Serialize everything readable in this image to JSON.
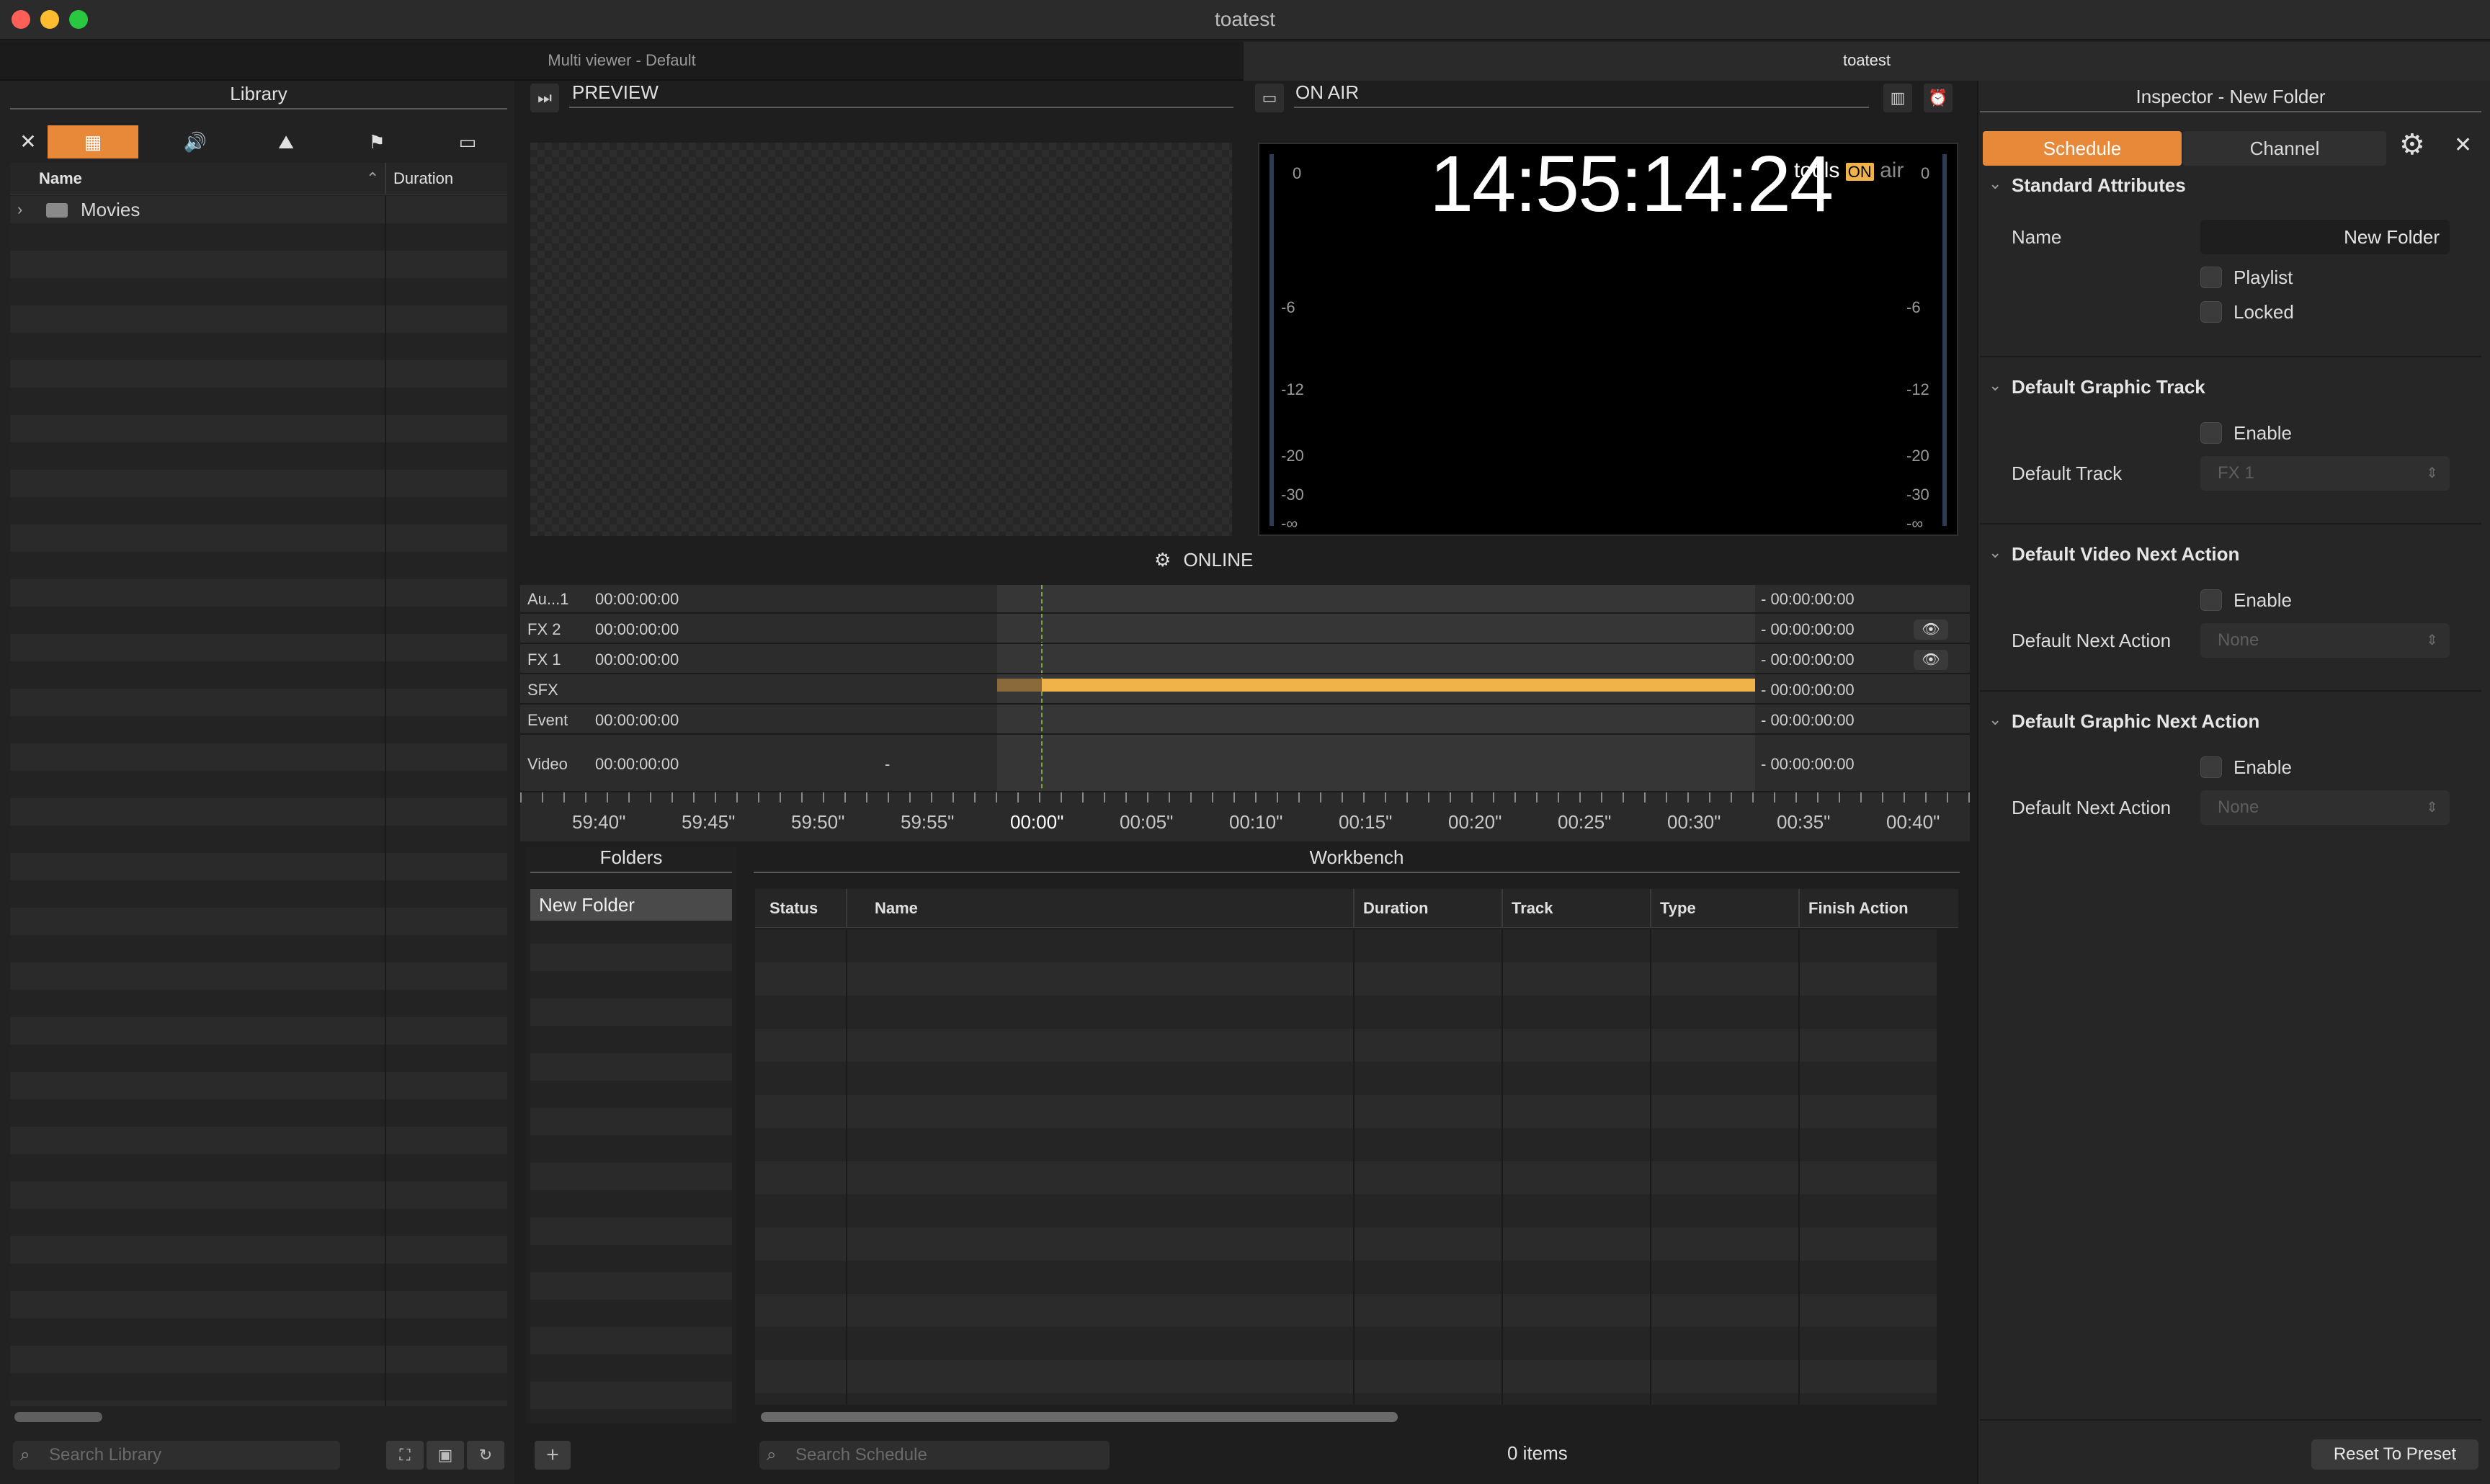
{
  "window": {
    "title": "toatest",
    "traffic_lights": {
      "close": "#fe5f57",
      "minimize": "#febc2e",
      "maximize": "#28c840"
    }
  },
  "tabs": [
    {
      "label": "Multi viewer - Default",
      "active": false
    },
    {
      "label": "toatest",
      "active": true
    }
  ],
  "library": {
    "title": "Library",
    "toolbar": [
      {
        "icon": "close-icon",
        "glyph": "✕",
        "active": false
      },
      {
        "icon": "film-icon",
        "glyph": "▦",
        "active": true
      },
      {
        "icon": "speaker-icon",
        "glyph": "🔊",
        "active": false
      },
      {
        "icon": "mountain-icon",
        "glyph": "⛰",
        "active": false
      },
      {
        "icon": "flag-icon",
        "glyph": "⚑",
        "active": false
      },
      {
        "icon": "window-icon",
        "glyph": "▭",
        "active": false
      }
    ],
    "columns": {
      "name": "Name",
      "duration": "Duration"
    },
    "items": [
      {
        "name": "Movies",
        "type": "folder"
      }
    ],
    "search_placeholder": "Search Library"
  },
  "preview": {
    "title": "PREVIEW"
  },
  "onair": {
    "title": "ON AIR",
    "clock": "14:55:14:24",
    "logo_text": "tools",
    "logo_badge": "ON",
    "logo_tail": "air",
    "meter_labels": [
      "0",
      "-6",
      "-12",
      "-20",
      "-30",
      "-∞"
    ],
    "status": "ONLINE"
  },
  "timeline": {
    "tracks": [
      {
        "name": "Au...1",
        "in": "00:00:00:00",
        "out": "- 00:00:00:00",
        "eye": false
      },
      {
        "name": "FX 2",
        "in": "00:00:00:00",
        "out": "- 00:00:00:00",
        "eye": true
      },
      {
        "name": "FX 1",
        "in": "00:00:00:00",
        "out": "- 00:00:00:00",
        "eye": true
      },
      {
        "name": "SFX",
        "in": "",
        "out": "- 00:00:00:00",
        "eye": false
      },
      {
        "name": "Event",
        "in": "00:00:00:00",
        "out": "- 00:00:00:00",
        "eye": false
      },
      {
        "name": "Video",
        "in": "00:00:00:00",
        "out": "- 00:00:00:00",
        "eye": false,
        "extra": "-"
      }
    ],
    "ruler": [
      "59:40\"",
      "59:45\"",
      "59:50\"",
      "59:55\"",
      "00:00\"",
      "00:05\"",
      "00:10\"",
      "00:15\"",
      "00:20\"",
      "00:25\"",
      "00:30\"",
      "00:35\"",
      "00:40\""
    ],
    "accent": "#f0b34a"
  },
  "folders": {
    "title": "Folders",
    "items": [
      "New Folder"
    ],
    "add_label": "+"
  },
  "workbench": {
    "title": "Workbench",
    "columns": [
      "Status",
      "Name",
      "Duration",
      "Track",
      "Type",
      "Finish Action"
    ],
    "search_placeholder": "Search Schedule",
    "count_label": "0 items"
  },
  "inspector": {
    "title": "Inspector - New Folder",
    "tabs": [
      {
        "label": "Schedule",
        "active": true
      },
      {
        "label": "Channel",
        "active": false
      }
    ],
    "accent": "#e8893a",
    "sections": {
      "standard": {
        "title": "Standard Attributes",
        "name_label": "Name",
        "name_value": "New Folder",
        "playlist": "Playlist",
        "locked": "Locked"
      },
      "graphic_track": {
        "title": "Default Graphic Track",
        "enable": "Enable",
        "track_label": "Default Track",
        "track_value": "FX 1"
      },
      "video_next": {
        "title": "Default Video Next Action",
        "enable": "Enable",
        "action_label": "Default Next Action",
        "action_value": "None"
      },
      "graphic_next": {
        "title": "Default Graphic Next Action",
        "enable": "Enable",
        "action_label": "Default Next Action",
        "action_value": "None"
      }
    },
    "reset_label": "Reset To Preset"
  }
}
